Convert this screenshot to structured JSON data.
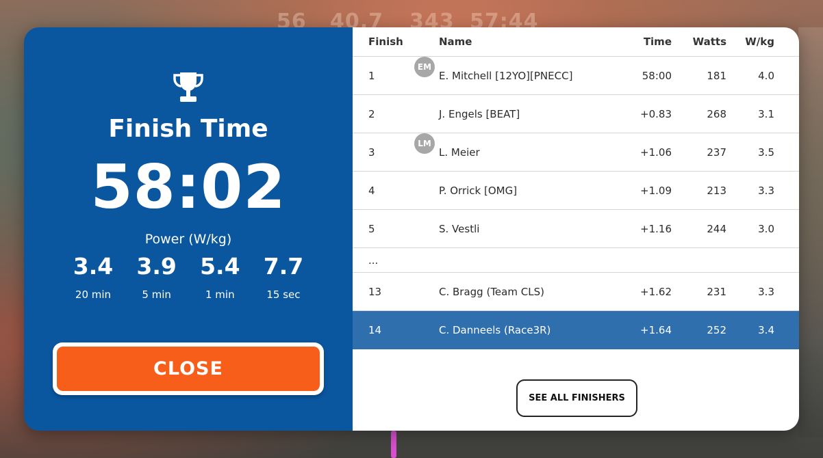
{
  "hud": {
    "speed": "56",
    "distance": "40.7",
    "elevation": "343",
    "elapsed": "57:44"
  },
  "summary": {
    "title": "Finish Time",
    "finish_time": "58:02",
    "power_label": "Power (W/kg)",
    "power": [
      {
        "value": "3.4",
        "duration": "20 min"
      },
      {
        "value": "3.9",
        "duration": "5 min"
      },
      {
        "value": "5.4",
        "duration": "1 min"
      },
      {
        "value": "7.7",
        "duration": "15 sec"
      }
    ],
    "close_label": "CLOSE"
  },
  "results": {
    "columns": {
      "finish": "Finish",
      "name": "Name",
      "time": "Time",
      "watts": "Watts",
      "wkg": "W/kg"
    },
    "rows": [
      {
        "finish": "1",
        "avatar": "EM",
        "name": "E. Mitchell [12YO][PNECC]",
        "time": "58:00",
        "watts": "181",
        "wkg": "4.0"
      },
      {
        "finish": "2",
        "avatar": "",
        "name": "J. Engels [BEAT]",
        "time": "+0.83",
        "watts": "268",
        "wkg": "3.1"
      },
      {
        "finish": "3",
        "avatar": "LM",
        "name": "L. Meier",
        "time": "+1.06",
        "watts": "237",
        "wkg": "3.5"
      },
      {
        "finish": "4",
        "avatar": "",
        "name": "P. Orrick [OMG]",
        "time": "+1.09",
        "watts": "213",
        "wkg": "3.3"
      },
      {
        "finish": "5",
        "avatar": "",
        "name": "S. Vestli",
        "time": "+1.16",
        "watts": "244",
        "wkg": "3.0"
      }
    ],
    "ellipsis": "...",
    "rows_after": [
      {
        "finish": "13",
        "avatar": "",
        "name": "C. Bragg (Team CLS)",
        "time": "+1.62",
        "watts": "231",
        "wkg": "3.3"
      },
      {
        "finish": "14",
        "avatar": "",
        "name": "C. Danneels (Race3R)",
        "time": "+1.64",
        "watts": "252",
        "wkg": "3.4"
      }
    ],
    "see_all_label": "SEE ALL FINISHERS"
  },
  "colors": {
    "panel_blue": "#0a57a0",
    "close_orange": "#f75e1a",
    "highlight_row": "#2f6fad"
  }
}
